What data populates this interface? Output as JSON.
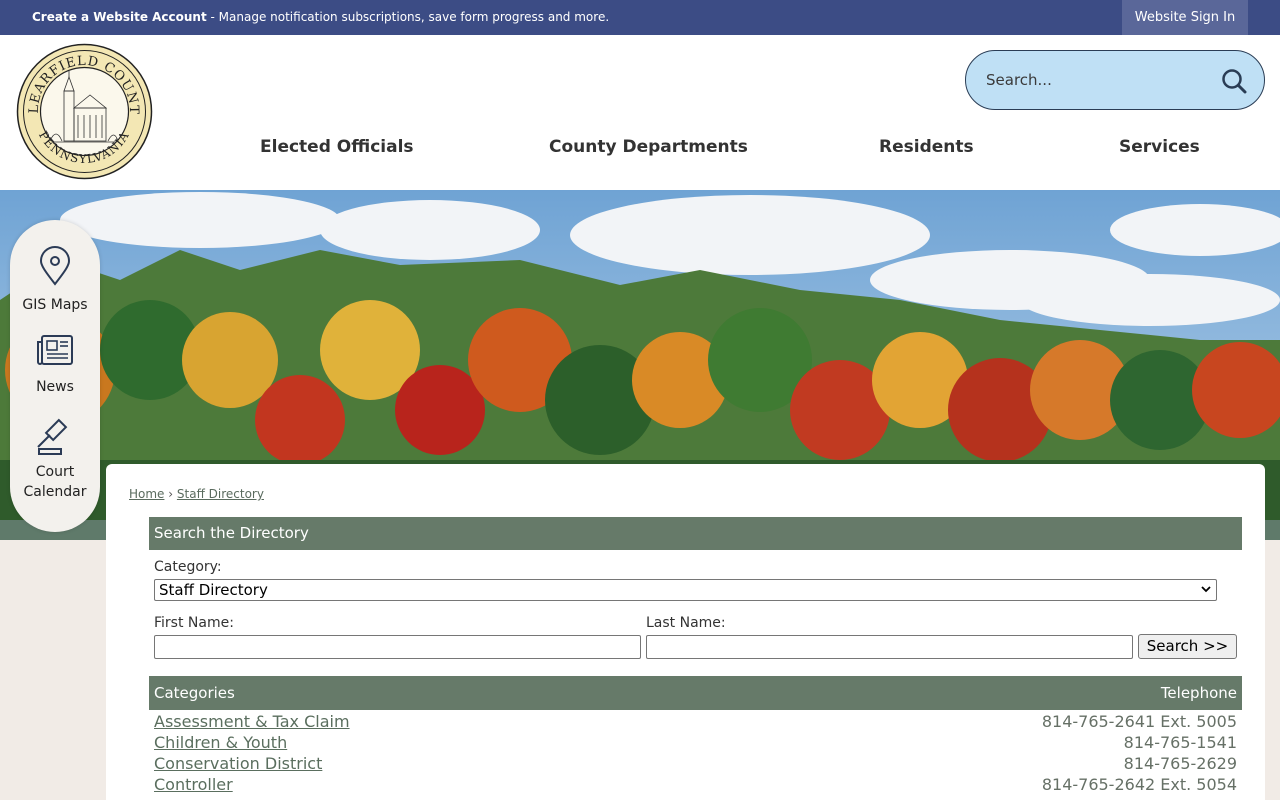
{
  "topbar": {
    "create_account": "Create a Website Account",
    "message": " - Manage notification subscriptions, save form progress and more.",
    "sign_in": "Website Sign In"
  },
  "header": {
    "logo_text_top": "CLEARFIELD COUNTY",
    "logo_text_bottom": "PENNSYLVANIA",
    "search_placeholder": "Search...",
    "nav": [
      "Elected Officials",
      "County Departments",
      "Residents",
      "Services"
    ]
  },
  "quick_links": [
    {
      "label": "GIS Maps",
      "icon": "map-pin-icon"
    },
    {
      "label": "News",
      "icon": "newspaper-icon"
    },
    {
      "label": "Court Calendar",
      "icon": "gavel-icon"
    }
  ],
  "breadcrumb": {
    "home": "Home",
    "separator": "›",
    "current": "Staff Directory"
  },
  "search_panel": {
    "title": "Search the Directory",
    "category_label": "Category:",
    "category_value": "Staff Directory",
    "first_name_label": "First Name:",
    "last_name_label": "Last Name:",
    "search_button": "Search >>"
  },
  "categories_table": {
    "headers": [
      "Categories",
      "Telephone"
    ],
    "rows": [
      {
        "name": "Assessment & Tax Claim",
        "telephone": "814-765-2641 Ext. 5005"
      },
      {
        "name": "Children & Youth",
        "telephone": "814-765-1541"
      },
      {
        "name": "Conservation District",
        "telephone": "814-765-2629"
      },
      {
        "name": "Controller",
        "telephone": "814-765-2642 Ext. 5054"
      }
    ]
  },
  "colors": {
    "topbar": "#3c4c85",
    "panel_header": "#667a69",
    "search_bg": "#bfe0f5",
    "link": "#5a6e5e"
  }
}
